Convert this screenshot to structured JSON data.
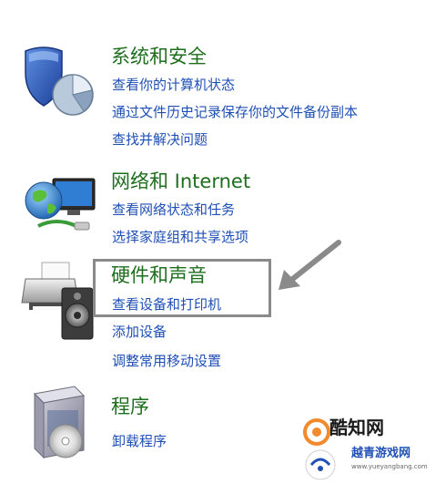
{
  "categories": [
    {
      "title": "系统和安全",
      "icon": "shield-pie-chart-icon",
      "links": [
        "查看你的计算机状态",
        "通过文件历史记录保存你的文件备份副本",
        "查找并解决问题"
      ]
    },
    {
      "title": "网络和 Internet",
      "icon": "globe-network-icon",
      "links": [
        "查看网络状态和任务",
        "选择家庭组和共享选项"
      ]
    },
    {
      "title": "硬件和声音",
      "icon": "printer-speaker-icon",
      "links": [
        "查看设备和打印机",
        "添加设备",
        "调整常用移动设置"
      ]
    },
    {
      "title": "程序",
      "icon": "programs-box-icon",
      "links": [
        "卸载程序"
      ]
    }
  ],
  "colors": {
    "category_title": "#1e6e1e",
    "link": "#1f4fb5",
    "highlight_border": "#8a8a8a",
    "arrow": "#8a8a8a"
  },
  "watermark": {
    "main": "酷知网",
    "sub": "越青游戏网",
    "url": "www.yueyangbang.com",
    "icon": "watermark-logo-icon"
  }
}
